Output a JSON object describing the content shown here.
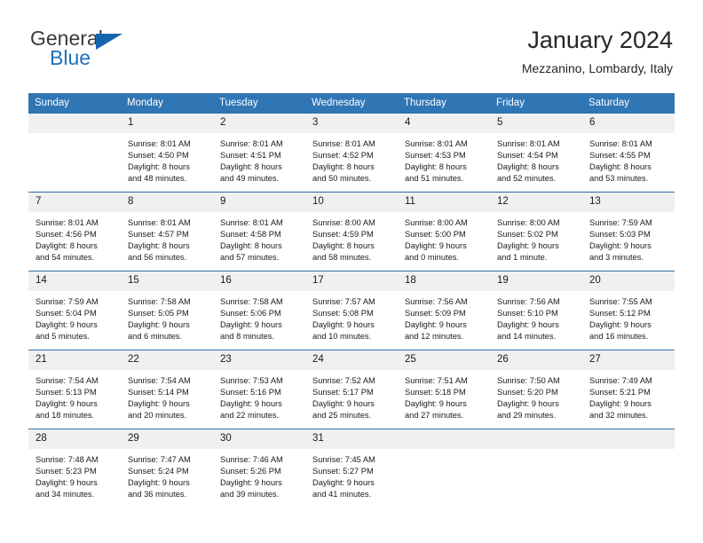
{
  "brand": {
    "name_part1": "General",
    "name_part2": "Blue",
    "triangle_icon": "triangle-icon",
    "accent_color": "#1565ad"
  },
  "header": {
    "title": "January 2024",
    "subtitle": "Mezzanino, Lombardy, Italy"
  },
  "theme": {
    "header_bg": "#3075b4",
    "daynum_bg": "#f0f0f0",
    "rule_color": "#2f6fa8"
  },
  "weekday_headers": [
    "Sunday",
    "Monday",
    "Tuesday",
    "Wednesday",
    "Thursday",
    "Friday",
    "Saturday"
  ],
  "weeks": [
    [
      {
        "day": "",
        "sunrise": "",
        "sunset": "",
        "daylight1": "",
        "daylight2": ""
      },
      {
        "day": "1",
        "sunrise": "Sunrise: 8:01 AM",
        "sunset": "Sunset: 4:50 PM",
        "daylight1": "Daylight: 8 hours",
        "daylight2": "and 48 minutes."
      },
      {
        "day": "2",
        "sunrise": "Sunrise: 8:01 AM",
        "sunset": "Sunset: 4:51 PM",
        "daylight1": "Daylight: 8 hours",
        "daylight2": "and 49 minutes."
      },
      {
        "day": "3",
        "sunrise": "Sunrise: 8:01 AM",
        "sunset": "Sunset: 4:52 PM",
        "daylight1": "Daylight: 8 hours",
        "daylight2": "and 50 minutes."
      },
      {
        "day": "4",
        "sunrise": "Sunrise: 8:01 AM",
        "sunset": "Sunset: 4:53 PM",
        "daylight1": "Daylight: 8 hours",
        "daylight2": "and 51 minutes."
      },
      {
        "day": "5",
        "sunrise": "Sunrise: 8:01 AM",
        "sunset": "Sunset: 4:54 PM",
        "daylight1": "Daylight: 8 hours",
        "daylight2": "and 52 minutes."
      },
      {
        "day": "6",
        "sunrise": "Sunrise: 8:01 AM",
        "sunset": "Sunset: 4:55 PM",
        "daylight1": "Daylight: 8 hours",
        "daylight2": "and 53 minutes."
      }
    ],
    [
      {
        "day": "7",
        "sunrise": "Sunrise: 8:01 AM",
        "sunset": "Sunset: 4:56 PM",
        "daylight1": "Daylight: 8 hours",
        "daylight2": "and 54 minutes."
      },
      {
        "day": "8",
        "sunrise": "Sunrise: 8:01 AM",
        "sunset": "Sunset: 4:57 PM",
        "daylight1": "Daylight: 8 hours",
        "daylight2": "and 56 minutes."
      },
      {
        "day": "9",
        "sunrise": "Sunrise: 8:01 AM",
        "sunset": "Sunset: 4:58 PM",
        "daylight1": "Daylight: 8 hours",
        "daylight2": "and 57 minutes."
      },
      {
        "day": "10",
        "sunrise": "Sunrise: 8:00 AM",
        "sunset": "Sunset: 4:59 PM",
        "daylight1": "Daylight: 8 hours",
        "daylight2": "and 58 minutes."
      },
      {
        "day": "11",
        "sunrise": "Sunrise: 8:00 AM",
        "sunset": "Sunset: 5:00 PM",
        "daylight1": "Daylight: 9 hours",
        "daylight2": "and 0 minutes."
      },
      {
        "day": "12",
        "sunrise": "Sunrise: 8:00 AM",
        "sunset": "Sunset: 5:02 PM",
        "daylight1": "Daylight: 9 hours",
        "daylight2": "and 1 minute."
      },
      {
        "day": "13",
        "sunrise": "Sunrise: 7:59 AM",
        "sunset": "Sunset: 5:03 PM",
        "daylight1": "Daylight: 9 hours",
        "daylight2": "and 3 minutes."
      }
    ],
    [
      {
        "day": "14",
        "sunrise": "Sunrise: 7:59 AM",
        "sunset": "Sunset: 5:04 PM",
        "daylight1": "Daylight: 9 hours",
        "daylight2": "and 5 minutes."
      },
      {
        "day": "15",
        "sunrise": "Sunrise: 7:58 AM",
        "sunset": "Sunset: 5:05 PM",
        "daylight1": "Daylight: 9 hours",
        "daylight2": "and 6 minutes."
      },
      {
        "day": "16",
        "sunrise": "Sunrise: 7:58 AM",
        "sunset": "Sunset: 5:06 PM",
        "daylight1": "Daylight: 9 hours",
        "daylight2": "and 8 minutes."
      },
      {
        "day": "17",
        "sunrise": "Sunrise: 7:57 AM",
        "sunset": "Sunset: 5:08 PM",
        "daylight1": "Daylight: 9 hours",
        "daylight2": "and 10 minutes."
      },
      {
        "day": "18",
        "sunrise": "Sunrise: 7:56 AM",
        "sunset": "Sunset: 5:09 PM",
        "daylight1": "Daylight: 9 hours",
        "daylight2": "and 12 minutes."
      },
      {
        "day": "19",
        "sunrise": "Sunrise: 7:56 AM",
        "sunset": "Sunset: 5:10 PM",
        "daylight1": "Daylight: 9 hours",
        "daylight2": "and 14 minutes."
      },
      {
        "day": "20",
        "sunrise": "Sunrise: 7:55 AM",
        "sunset": "Sunset: 5:12 PM",
        "daylight1": "Daylight: 9 hours",
        "daylight2": "and 16 minutes."
      }
    ],
    [
      {
        "day": "21",
        "sunrise": "Sunrise: 7:54 AM",
        "sunset": "Sunset: 5:13 PM",
        "daylight1": "Daylight: 9 hours",
        "daylight2": "and 18 minutes."
      },
      {
        "day": "22",
        "sunrise": "Sunrise: 7:54 AM",
        "sunset": "Sunset: 5:14 PM",
        "daylight1": "Daylight: 9 hours",
        "daylight2": "and 20 minutes."
      },
      {
        "day": "23",
        "sunrise": "Sunrise: 7:53 AM",
        "sunset": "Sunset: 5:16 PM",
        "daylight1": "Daylight: 9 hours",
        "daylight2": "and 22 minutes."
      },
      {
        "day": "24",
        "sunrise": "Sunrise: 7:52 AM",
        "sunset": "Sunset: 5:17 PM",
        "daylight1": "Daylight: 9 hours",
        "daylight2": "and 25 minutes."
      },
      {
        "day": "25",
        "sunrise": "Sunrise: 7:51 AM",
        "sunset": "Sunset: 5:18 PM",
        "daylight1": "Daylight: 9 hours",
        "daylight2": "and 27 minutes."
      },
      {
        "day": "26",
        "sunrise": "Sunrise: 7:50 AM",
        "sunset": "Sunset: 5:20 PM",
        "daylight1": "Daylight: 9 hours",
        "daylight2": "and 29 minutes."
      },
      {
        "day": "27",
        "sunrise": "Sunrise: 7:49 AM",
        "sunset": "Sunset: 5:21 PM",
        "daylight1": "Daylight: 9 hours",
        "daylight2": "and 32 minutes."
      }
    ],
    [
      {
        "day": "28",
        "sunrise": "Sunrise: 7:48 AM",
        "sunset": "Sunset: 5:23 PM",
        "daylight1": "Daylight: 9 hours",
        "daylight2": "and 34 minutes."
      },
      {
        "day": "29",
        "sunrise": "Sunrise: 7:47 AM",
        "sunset": "Sunset: 5:24 PM",
        "daylight1": "Daylight: 9 hours",
        "daylight2": "and 36 minutes."
      },
      {
        "day": "30",
        "sunrise": "Sunrise: 7:46 AM",
        "sunset": "Sunset: 5:26 PM",
        "daylight1": "Daylight: 9 hours",
        "daylight2": "and 39 minutes."
      },
      {
        "day": "31",
        "sunrise": "Sunrise: 7:45 AM",
        "sunset": "Sunset: 5:27 PM",
        "daylight1": "Daylight: 9 hours",
        "daylight2": "and 41 minutes."
      },
      {
        "day": "",
        "sunrise": "",
        "sunset": "",
        "daylight1": "",
        "daylight2": ""
      },
      {
        "day": "",
        "sunrise": "",
        "sunset": "",
        "daylight1": "",
        "daylight2": ""
      },
      {
        "day": "",
        "sunrise": "",
        "sunset": "",
        "daylight1": "",
        "daylight2": ""
      }
    ]
  ]
}
